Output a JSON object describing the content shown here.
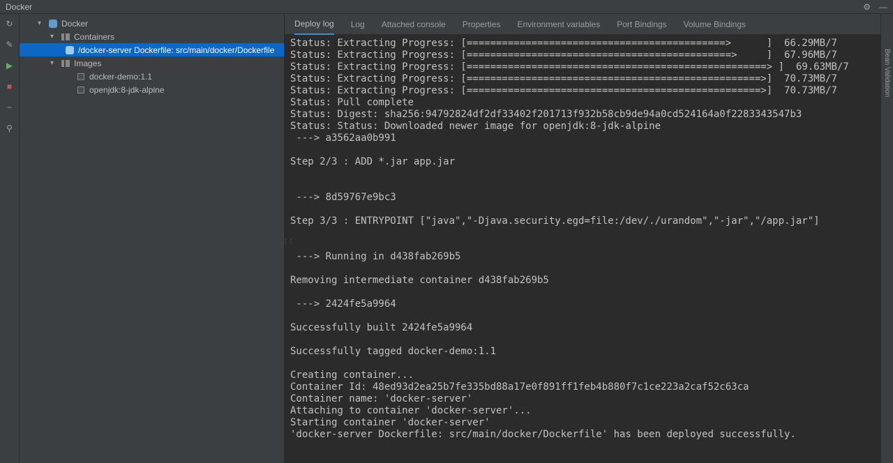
{
  "titlebar": {
    "title": "Docker"
  },
  "tree": {
    "docker": "Docker",
    "containers": "Containers",
    "dockerfile": "/docker-server Dockerfile: src/main/docker/Dockerfile",
    "images": "Images",
    "image1": "docker-demo:1.1",
    "image2": "openjdk:8-jdk-alpine"
  },
  "tabs": {
    "deploy_log": "Deploy log",
    "log": "Log",
    "attached_console": "Attached console",
    "properties": "Properties",
    "env_vars": "Environment variables",
    "port_bindings": "Port Bindings",
    "volume_bindings": "Volume Bindings"
  },
  "console_lines": [
    "Status: Extracting Progress: [============================================>      ]  66.29MB/7",
    "Status: Extracting Progress: [=============================================>     ]  67.96MB/7",
    "Status: Extracting Progress: [===================================================> ]  69.63MB/7",
    "Status: Extracting Progress: [==================================================>]  70.73MB/7",
    "Status: Extracting Progress: [==================================================>]  70.73MB/7",
    "Status: Pull complete",
    "Status: Digest: sha256:94792824df2df33402f201713f932b58cb9de94a0cd524164a0f2283343547b3",
    "Status: Status: Downloaded newer image for openjdk:8-jdk-alpine",
    " ---> a3562aa0b991",
    "",
    "Step 2/3 : ADD *.jar app.jar",
    "",
    "",
    " ---> 8d59767e9bc3",
    "",
    "Step 3/3 : ENTRYPOINT [\"java\",\"-Djava.security.egd=file:/dev/./urandom\",\"-jar\",\"/app.jar\"]",
    "",
    "",
    " ---> Running in d438fab269b5",
    "",
    "Removing intermediate container d438fab269b5",
    "",
    " ---> 2424fe5a9964",
    "",
    "Successfully built 2424fe5a9964",
    "",
    "Successfully tagged docker-demo:1.1",
    "",
    "Creating container...",
    "Container Id: 48ed93d2ea25b7fe335bd88a17e0f891ff1feb4b880f7c1ce223a2caf52c63ca",
    "Container name: 'docker-server'",
    "Attaching to container 'docker-server'...",
    "Starting container 'docker-server'",
    "'docker-server Dockerfile: src/main/docker/Dockerfile' has been deployed successfully.",
    ""
  ],
  "right_edge": {
    "label": "Bean Validation"
  }
}
